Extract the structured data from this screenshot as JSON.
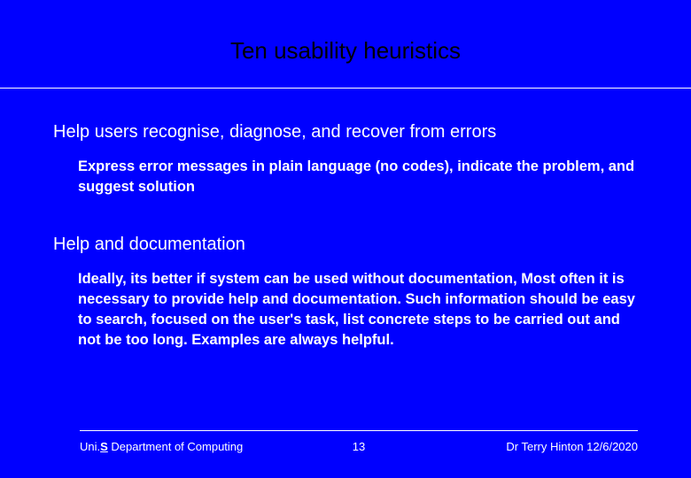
{
  "title": "Ten usability heuristics",
  "sections": [
    {
      "heading": "Help users recognise, diagnose, and recover from errors",
      "body": "Express error messages in plain language (no codes), indicate the problem, and suggest solution"
    },
    {
      "heading": "Help and documentation",
      "body": "Ideally, its better if system can be used without documentation, Most often it is necessary to provide help and documentation. Such information should be easy to search, focused on the user's task, list concrete steps to be carried out and not be too long. Examples are always helpful."
    }
  ],
  "footer": {
    "uni_prefix": "Uni.",
    "uni_s": "S",
    "dept": " Department of Computing",
    "page_number": "13",
    "author_date": "Dr Terry Hinton 12/6/2020"
  }
}
